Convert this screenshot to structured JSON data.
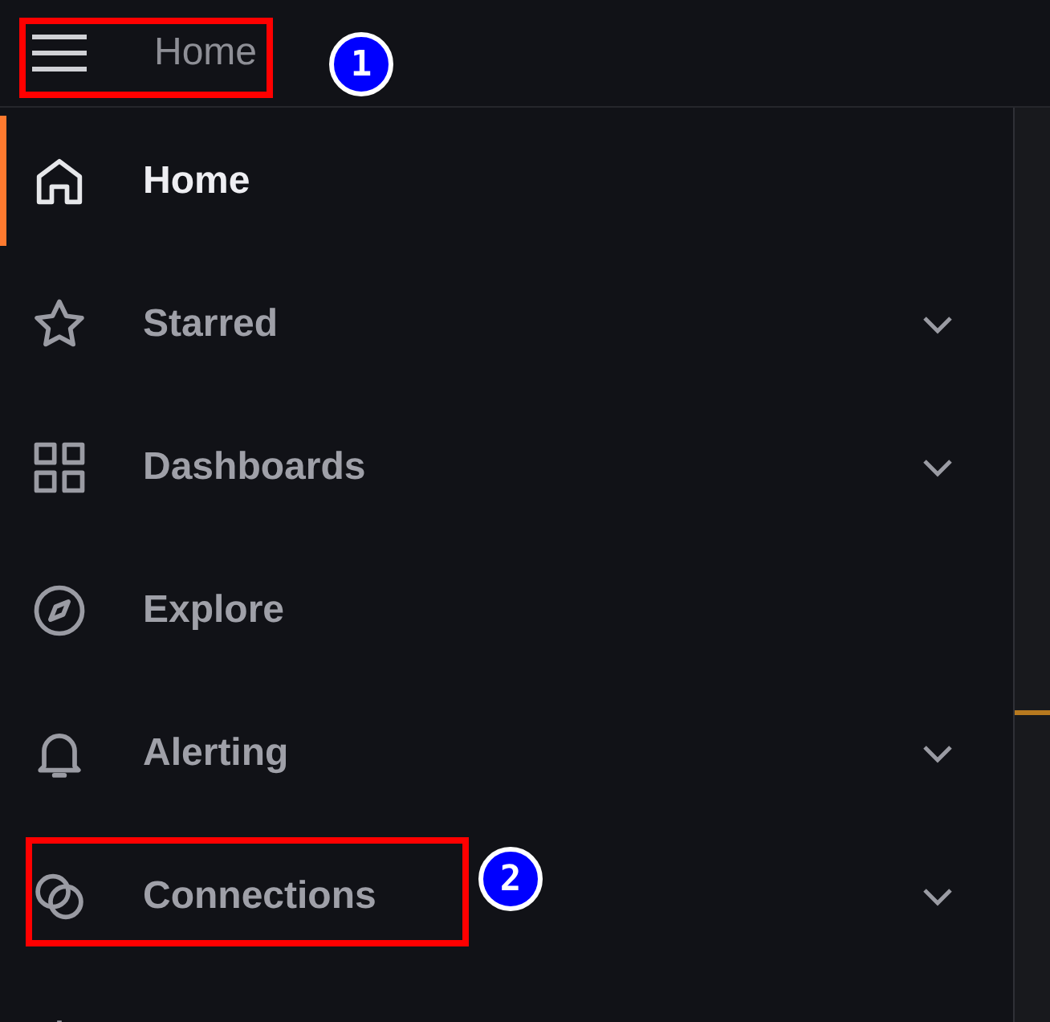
{
  "top_bar": {
    "title": "Home"
  },
  "nav": {
    "items": [
      {
        "label": "Home",
        "kind": "home",
        "selected": true,
        "has_children": false
      },
      {
        "label": "Starred",
        "kind": "star",
        "selected": false,
        "has_children": true
      },
      {
        "label": "Dashboards",
        "kind": "grid",
        "selected": false,
        "has_children": true
      },
      {
        "label": "Explore",
        "kind": "compass",
        "selected": false,
        "has_children": false
      },
      {
        "label": "Alerting",
        "kind": "bell",
        "selected": false,
        "has_children": true
      },
      {
        "label": "Connections",
        "kind": "rings",
        "selected": false,
        "has_children": true
      }
    ]
  },
  "callouts": [
    {
      "number": "1"
    },
    {
      "number": "2"
    }
  ]
}
